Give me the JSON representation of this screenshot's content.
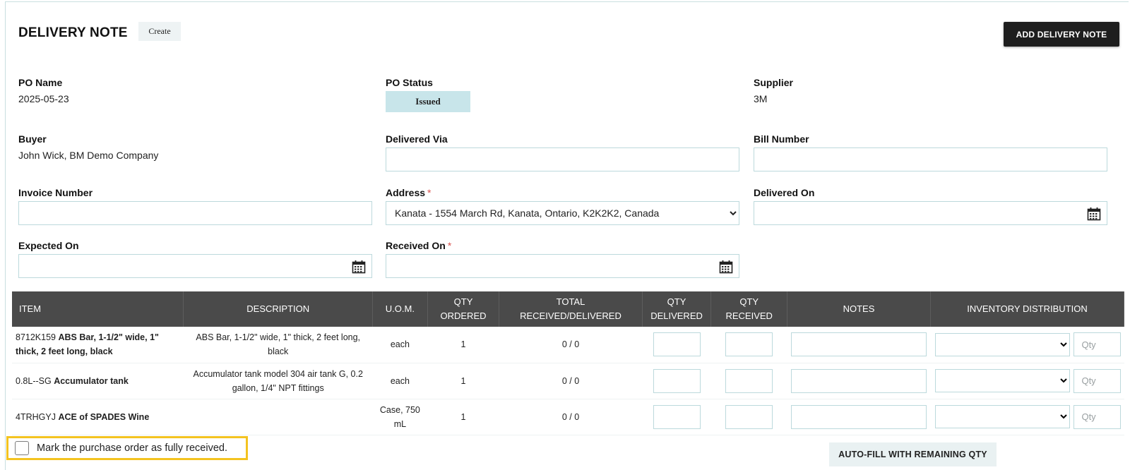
{
  "header": {
    "title": "DELIVERY NOTE",
    "mode_chip": "Create",
    "add_button": "ADD DELIVERY NOTE"
  },
  "info": {
    "po_name": {
      "label": "PO Name",
      "value": "2025-05-23"
    },
    "po_status": {
      "label": "PO Status",
      "value": "Issued"
    },
    "supplier": {
      "label": "Supplier",
      "value": "3M"
    },
    "buyer": {
      "label": "Buyer",
      "value": "John Wick, BM Demo Company"
    }
  },
  "form": {
    "delivered_via": {
      "label": "Delivered Via",
      "value": ""
    },
    "bill_number": {
      "label": "Bill Number",
      "value": ""
    },
    "invoice_number": {
      "label": "Invoice Number",
      "value": ""
    },
    "address": {
      "label": "Address",
      "required_mark": "*",
      "selected": "Kanata - 1554 March Rd, Kanata, Ontario, K2K2K2, Canada"
    },
    "delivered_on": {
      "label": "Delivered On",
      "value": ""
    },
    "expected_on": {
      "label": "Expected On",
      "value": ""
    },
    "received_on": {
      "label": "Received On",
      "required_mark": "*",
      "value": ""
    }
  },
  "table": {
    "headers": {
      "item": "ITEM",
      "description": "DESCRIPTION",
      "uom": "U.O.M.",
      "qty_ordered_1": "QTY",
      "qty_ordered_2": "ORDERED",
      "total_1": "TOTAL",
      "total_2": "RECEIVED/DELIVERED",
      "qty_delivered_1": "QTY",
      "qty_delivered_2": "DELIVERED",
      "qty_received_1": "QTY",
      "qty_received_2": "RECEIVED",
      "notes": "NOTES",
      "inventory": "INVENTORY DISTRIBUTION"
    },
    "qty_placeholder": "Qty",
    "rows": [
      {
        "code": "8712K159",
        "name": "ABS Bar, 1-1/2\" wide, 1\" thick, 2 feet long, black",
        "description": "ABS Bar, 1-1/2\" wide, 1\" thick, 2 feet long, black",
        "uom": "each",
        "qty_ordered": "1",
        "total": "0 / 0"
      },
      {
        "code": "0.8L--SG",
        "name": "Accumulator tank",
        "description": "Accumulator tank model 304 air tank G, 0.2 gallon, 1/4\" NPT fittings",
        "uom": "each",
        "qty_ordered": "1",
        "total": "0 / 0"
      },
      {
        "code": "4TRHGYJ",
        "name": "ACE of SPADES Wine",
        "description": "",
        "uom": "Case, 750 mL",
        "qty_ordered": "1",
        "total": "0 / 0"
      }
    ]
  },
  "footer": {
    "mark_label": "Mark the purchase order as fully received.",
    "autofill_button": "AUTO-FILL WITH REMAINING QTY"
  },
  "icons": {
    "calendar": "calendar-icon",
    "dropdown": "chevron-down-icon"
  },
  "colors": {
    "accent_border": "#bcd9dc",
    "status_badge": "#c8e5ea",
    "table_header": "#4a4a4a",
    "highlight": "#f4c320"
  }
}
